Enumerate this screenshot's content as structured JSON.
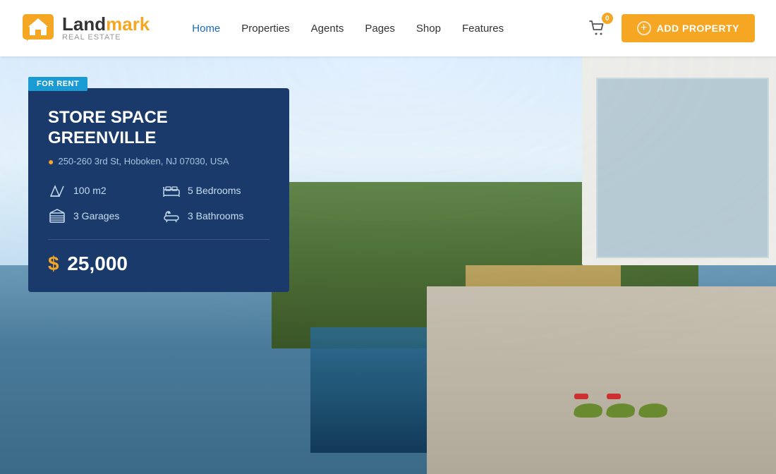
{
  "logo": {
    "land": "Land",
    "mark": "mark",
    "sub": "Real Estate"
  },
  "nav": {
    "items": [
      {
        "label": "Home",
        "active": true
      },
      {
        "label": "Properties",
        "active": false
      },
      {
        "label": "Agents",
        "active": false
      },
      {
        "label": "Pages",
        "active": false
      },
      {
        "label": "Shop",
        "active": false
      },
      {
        "label": "Features",
        "active": false
      }
    ]
  },
  "cart": {
    "badge": "0"
  },
  "add_property_btn": "ADD PROPERTY",
  "property": {
    "badge": "FOR RENT",
    "title": "STORE SPACE GREENVILLE",
    "address": "250-260 3rd St, Hoboken, NJ 07030, USA",
    "features": [
      {
        "icon": "area-icon",
        "label": "100 m2"
      },
      {
        "icon": "bed-icon",
        "label": "5 Bedrooms"
      },
      {
        "icon": "garage-icon",
        "label": "3 Garages"
      },
      {
        "icon": "bath-icon",
        "label": "3 Bathrooms"
      }
    ],
    "price_symbol": "$",
    "price": "25,000"
  }
}
